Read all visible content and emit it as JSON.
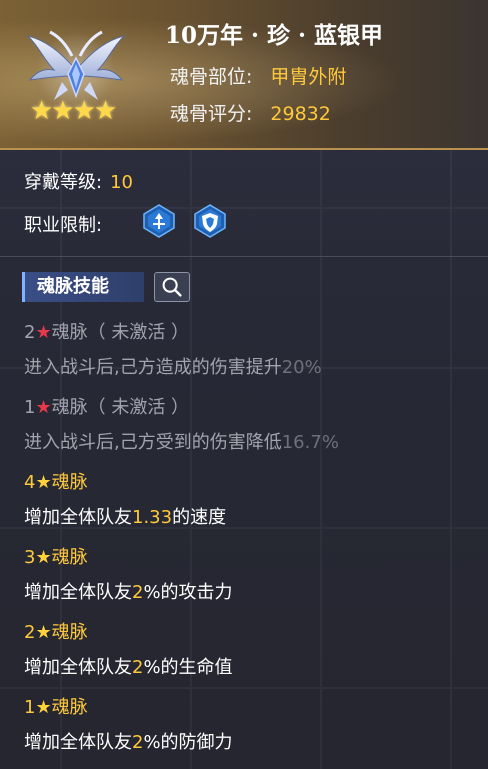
{
  "item": {
    "title": "10万年 · 珍 · 蓝银甲",
    "stars": "★★★★",
    "position_label": "魂骨部位:",
    "position_value": "甲胄外附",
    "score_label": "魂骨评分:",
    "score_value": "29832"
  },
  "attributes": {
    "level_label": "穿戴等级:",
    "level_value": "10",
    "job_label": "职业限制:",
    "job_icons": [
      "assault-class-icon",
      "defense-class-icon"
    ]
  },
  "skills": {
    "tab_label": "魂脉技能",
    "entries": [
      {
        "stars": "2",
        "star_glyph": "★",
        "name": "魂脉",
        "status": "（ 未激活 ）",
        "desc_prefix": "进入战斗后,己方造成的伤害提升",
        "desc_value": "20%",
        "desc_suffix": "",
        "active": false
      },
      {
        "stars": "1",
        "star_glyph": "★",
        "name": "魂脉",
        "status": "（ 未激活 ）",
        "desc_prefix": "进入战斗后,己方受到的伤害降低",
        "desc_value": "16.7%",
        "desc_suffix": "",
        "active": false
      },
      {
        "stars": "4",
        "star_glyph": "★",
        "name": "魂脉",
        "status": "",
        "desc_prefix": "增加全体队友",
        "desc_value": "1.33",
        "desc_suffix": "的速度",
        "active": true
      },
      {
        "stars": "3",
        "star_glyph": "★",
        "name": "魂脉",
        "status": "",
        "desc_prefix": "增加全体队友",
        "desc_value": "2",
        "desc_suffix": "%的攻击力",
        "active": true
      },
      {
        "stars": "2",
        "star_glyph": "★",
        "name": "魂脉",
        "status": "",
        "desc_prefix": "增加全体队友",
        "desc_value": "2",
        "desc_suffix": "%的生命值",
        "active": true
      },
      {
        "stars": "1",
        "star_glyph": "★",
        "name": "魂脉",
        "status": "",
        "desc_prefix": "增加全体队友",
        "desc_value": "2",
        "desc_suffix": "%的防御力",
        "active": true
      }
    ]
  },
  "colors": {
    "gold": "#ffc93c",
    "inactive_text": "#a2a3ad",
    "red_star": "#e8384a",
    "header_bg": "#7b6134",
    "body_bg": "#2b2d3b"
  }
}
